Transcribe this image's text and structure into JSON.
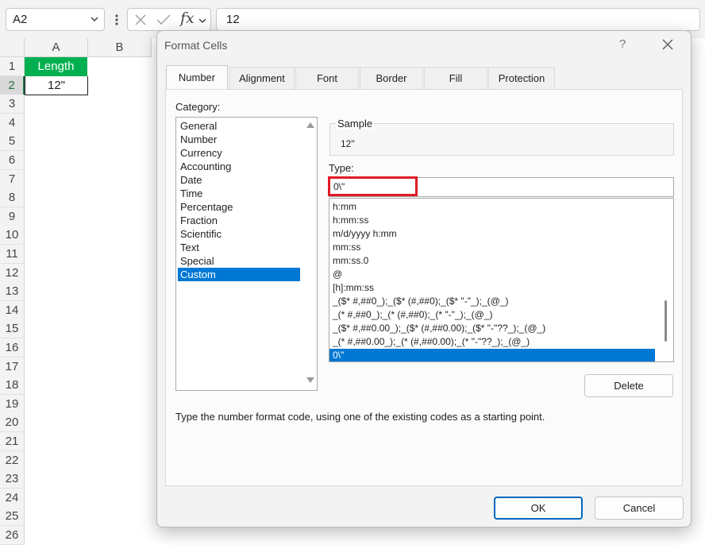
{
  "formula_bar": {
    "name_box": "A2",
    "formula": "12",
    "fx_label": "fx"
  },
  "sheet": {
    "columns": [
      "A",
      "B"
    ],
    "rows": [
      "1",
      "2",
      "3",
      "4",
      "5",
      "6",
      "7",
      "8",
      "9",
      "10",
      "11",
      "12",
      "13",
      "14",
      "15",
      "16",
      "17",
      "18",
      "19",
      "20",
      "21",
      "22",
      "23",
      "24",
      "25",
      "26"
    ],
    "cell_a1": "Length",
    "cell_a2": "12\"",
    "colors": {
      "header_fill": "#00b050",
      "selected_header": "#1e7145"
    }
  },
  "dialog": {
    "title": "Format Cells",
    "help": "?",
    "tabs": [
      "Number",
      "Alignment",
      "Font",
      "Border",
      "Fill",
      "Protection"
    ],
    "active_tab": "Number",
    "category_label": "Category:",
    "categories": [
      "General",
      "Number",
      "Currency",
      "Accounting",
      "Date",
      "Time",
      "Percentage",
      "Fraction",
      "Scientific",
      "Text",
      "Special",
      "Custom"
    ],
    "selected_category": "Custom",
    "sample_label": "Sample",
    "sample_value": "12\"",
    "type_label": "Type:",
    "type_value": "0\\\"",
    "formats": [
      "h:mm",
      "h:mm:ss",
      "m/d/yyyy h:mm",
      "mm:ss",
      "mm:ss.0",
      "@",
      "[h]:mm:ss",
      "_($* #,##0_);_($* (#,##0);_($* \"-\"_);_(@_)",
      "_(* #,##0_);_(* (#,##0);_(* \"-\"_);_(@_)",
      "_($* #,##0.00_);_($* (#,##0.00);_($* \"-\"??_);_(@_)",
      "_(* #,##0.00_);_(* (#,##0.00);_(* \"-\"??_);_(@_)",
      "0\\\""
    ],
    "selected_format": "0\\\"",
    "delete_label": "Delete",
    "hint": "Type the number format code, using one of the existing codes as a starting point.",
    "ok_label": "OK",
    "cancel_label": "Cancel",
    "colors": {
      "selection": "#0078d4",
      "highlight_box": "#e01b24"
    }
  }
}
